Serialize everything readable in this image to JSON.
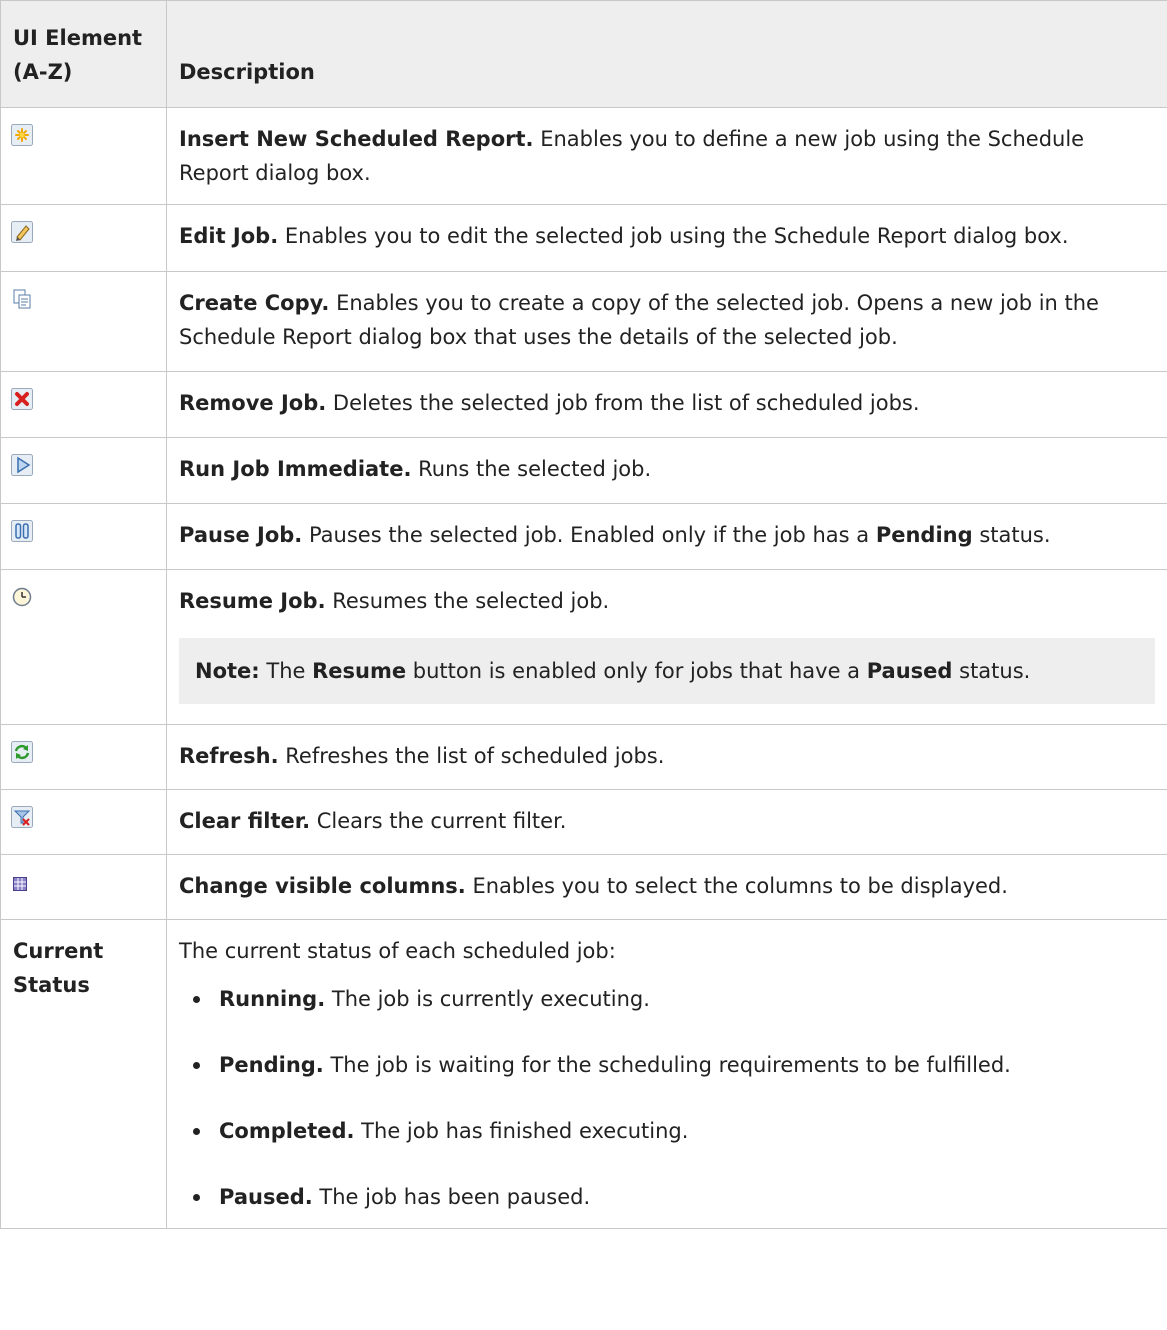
{
  "header": {
    "col1": "UI Element (A-Z)",
    "col2": "Description"
  },
  "rows": [
    {
      "icon": "insert-icon",
      "title": "Insert New Scheduled Report.",
      "desc": " Enables you to define a new job using the Schedule Report dialog box."
    },
    {
      "icon": "edit-pencil-icon",
      "title": "Edit Job.",
      "desc": " Enables you to edit the selected job using the Schedule Report dialog box."
    },
    {
      "icon": "copy-icon",
      "title": "Create Copy.",
      "desc": " Enables you to create a copy of the selected job. Opens a new job in the Schedule Report dialog box that uses the details of the selected job."
    },
    {
      "icon": "remove-x-icon",
      "title": "Remove Job.",
      "desc": " Deletes the selected job from the list of scheduled jobs."
    },
    {
      "icon": "run-play-icon",
      "title": "Run Job Immediate.",
      "desc": " Runs the selected job."
    },
    {
      "icon": "pause-icon",
      "title": "Pause Job.",
      "desc_a": " Pauses the selected job. Enabled only if the job has a ",
      "bold": "Pending",
      "desc_b": " status."
    },
    {
      "icon": "resume-clock-icon",
      "title": "Resume Job.",
      "desc": " Resumes the selected job.",
      "note": {
        "label": "Note:",
        "t1": " The ",
        "b1": "Resume",
        "t2": " button is enabled only for jobs that have a ",
        "b2": "Paused",
        "t3": " status."
      }
    },
    {
      "icon": "refresh-icon",
      "title": "Refresh.",
      "desc": " Refreshes the list of scheduled jobs."
    },
    {
      "icon": "clear-filter-icon",
      "title": "Clear filter.",
      "desc": " Clears the current filter."
    },
    {
      "icon": "columns-icon",
      "title": "Change visible columns.",
      "desc": " Enables you to select the columns to be displayed."
    }
  ],
  "status_row": {
    "label": "Current Status",
    "intro": "The current status of each scheduled job:",
    "items": [
      {
        "term": "Running.",
        "text": " The job is currently executing."
      },
      {
        "term": "Pending.",
        "text": " The job is waiting for the scheduling requirements to be fulfilled."
      },
      {
        "term": "Completed.",
        "text": " The job has finished executing."
      },
      {
        "term": "Paused.",
        "text": " The job has been paused."
      }
    ]
  }
}
